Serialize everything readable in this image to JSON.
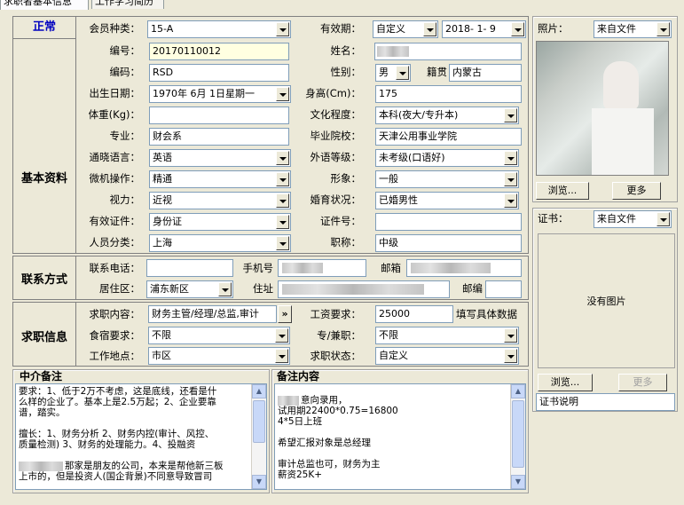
{
  "tabs": [
    "求职者基本信息",
    "工作学习简历"
  ],
  "status": "正常",
  "basic": {
    "member_type_label": "会员种类：",
    "member_type": "15-A",
    "valid_period_label": "有效期：",
    "valid_period": "自定义",
    "valid_date": "2018- 1- 9",
    "id_label": "编号：",
    "id": "20170110012",
    "name_label": "姓名：",
    "code_label": "编码：",
    "code": "RSD",
    "gender_label": "性别：",
    "gender": "男",
    "native_label": "籍贯",
    "native": "内蒙古",
    "birth_label": "出生日期：",
    "birth": "1970年 6月 1日星期一",
    "height_label": "身高(Cm)：",
    "height": "175",
    "weight_label": "体重(Kg)：",
    "weight": "",
    "education_label": "文化程度：",
    "education": "本科(夜大/专升本)",
    "major_label": "专业：",
    "major": "财会系",
    "school_label": "毕业院校：",
    "school": "天津公用事业学院",
    "lang_label": "通晓语言：",
    "lang": "英语",
    "lang_level_label": "外语等级：",
    "lang_level": "未考级(口语好)",
    "computer_label": "微机操作：",
    "computer": "精通",
    "image_label": "形象：",
    "image": "一般",
    "vision_label": "视力：",
    "vision": "近视",
    "marital_label": "婚育状况：",
    "marital": "已婚男性",
    "cert_type_label": "有效证件：",
    "cert_type": "身份证",
    "cert_no_label": "证件号：",
    "cert_no": "",
    "category_label": "人员分类：",
    "category": "上海",
    "title_label": "职称：",
    "title": "中级",
    "section": "基本资料"
  },
  "contact": {
    "section": "联系方式",
    "phone_label": "联系电话：",
    "phone": "",
    "mobile_label": "手机号",
    "email_label": "邮箱",
    "district_label": "居住区：",
    "district": "浦东新区",
    "address_label": "住址",
    "zip_label": "邮编",
    "zip": ""
  },
  "job": {
    "section": "求职信息",
    "position_label": "求职内容：",
    "position": "财务主管/经理/总监,审计",
    "more": "»",
    "salary_label": "工资要求：",
    "salary": "25000",
    "salary_note": "填写具体数据",
    "board_label": "食宿要求：",
    "board": "不限",
    "parttime_label": "专/兼职：",
    "parttime": "不限",
    "location_label": "工作地点：",
    "location": "市区",
    "status_label": "求职状态：",
    "status": "自定义"
  },
  "agency_notes": {
    "title": "中介备注",
    "lines": [
      "要求：1、低于2万不考虑，这是底线，还看是什",
      "么样的企业了。基本上是2.5万起；2、企业要靠",
      "谱，踏实。",
      "",
      "擅长：1、财务分析 2、财务内控(审计、风控、",
      "质量检测) 3、财务的处理能力。4、投融资",
      "",
      "那家是朋友的公司，本来是帮他新三板",
      "上市的，但是投资人(国企背景)不同意导致冒司"
    ]
  },
  "remark": {
    "title": "备注内容",
    "lines": [
      "意向录用，",
      "试用期22400*0.75=16800",
      "4*5日上班",
      "",
      "希望汇报对象是总经理",
      "",
      "审计总监也可，财务为主",
      "薪资25K+"
    ]
  },
  "photo": {
    "label": "照片：",
    "source": "来自文件",
    "browse": "浏览...",
    "more": "更多"
  },
  "cert": {
    "label": "证书：",
    "source": "来自文件",
    "no_image": "没有图片",
    "browse": "浏览...",
    "more": "更多",
    "desc": "证书说明"
  }
}
